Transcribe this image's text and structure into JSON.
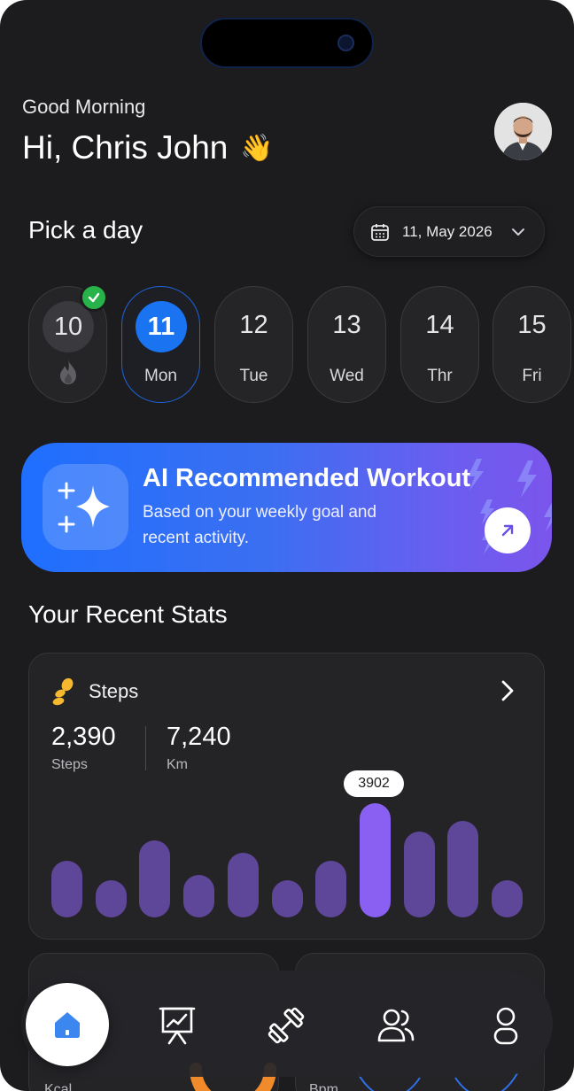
{
  "header": {
    "greeting": "Good Morning",
    "name": "Hi, Chris John",
    "wave_emoji": "👋"
  },
  "pick_day": {
    "title": "Pick a day",
    "date_label": "11, May 2026"
  },
  "days": [
    {
      "num": "10",
      "label": "",
      "state": "done",
      "icon": "flame-icon"
    },
    {
      "num": "11",
      "label": "Mon",
      "state": "active"
    },
    {
      "num": "12",
      "label": "Tue",
      "state": "default"
    },
    {
      "num": "13",
      "label": "Wed",
      "state": "default"
    },
    {
      "num": "14",
      "label": "Thr",
      "state": "default"
    },
    {
      "num": "15",
      "label": "Fri",
      "state": "default"
    }
  ],
  "ai_card": {
    "title": "AI Recommended Workout",
    "subtitle": "Based on your weekly goal and recent activity."
  },
  "stats": {
    "title": "Your Recent  Stats",
    "steps": {
      "label": "Steps",
      "metric1_value": "2,390",
      "metric1_unit": "Steps",
      "metric2_value": "7,240",
      "metric2_unit": "Km",
      "tooltip": "3902"
    },
    "mini_cards": [
      {
        "unit": "Kcal"
      },
      {
        "unit": "Bpm"
      }
    ]
  },
  "chart_data": {
    "type": "bar",
    "values": [
      64,
      42,
      87,
      48,
      73,
      42,
      64,
      129,
      97,
      109,
      42
    ],
    "highlight_index": 7,
    "highlight_label": "3902",
    "colors": {
      "bar": "#5e4698",
      "highlight": "#8a60f2"
    }
  },
  "nav": {
    "items": [
      "home-icon",
      "presentation-chart-icon",
      "dumbbell-icon",
      "users-icon",
      "profile-icon"
    ],
    "active": 0
  },
  "colors": {
    "background": "#1c1c1e",
    "accent_blue": "#1a74f2",
    "success_green": "#27b24a",
    "steps_icon": "#f5b82e"
  }
}
